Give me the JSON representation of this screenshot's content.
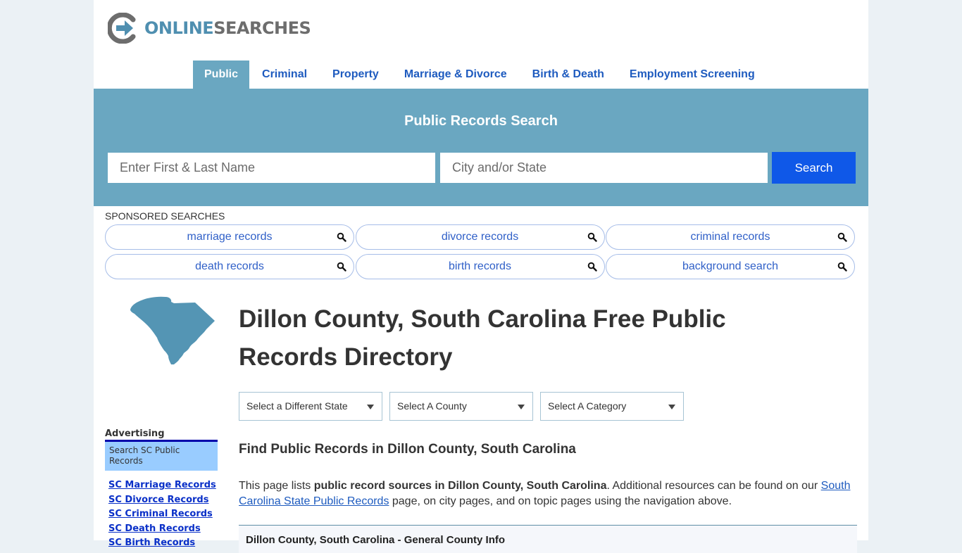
{
  "header": {
    "logo_online": "ONLINE",
    "logo_searches": "SEARCHES"
  },
  "nav": {
    "items": [
      {
        "label": "Public",
        "active": true
      },
      {
        "label": "Criminal"
      },
      {
        "label": "Property"
      },
      {
        "label": "Marriage & Divorce"
      },
      {
        "label": "Birth & Death"
      },
      {
        "label": "Employment Screening"
      }
    ]
  },
  "search": {
    "title": "Public Records Search",
    "name_placeholder": "Enter First & Last Name",
    "location_placeholder": "City and/or State",
    "button_label": "Search"
  },
  "sponsored": {
    "label": "SPONSORED SEARCHES",
    "items": [
      "marriage records",
      "divorce records",
      "criminal records",
      "death records",
      "birth records",
      "background search"
    ]
  },
  "sidebar": {
    "advertising_label": "Advertising",
    "box_text": "Search SC Public Records",
    "links": [
      "SC Marriage Records",
      "SC Divorce Records",
      "SC Criminal Records",
      "SC Death Records",
      "SC Birth Records"
    ]
  },
  "main": {
    "title": "Dillon County, South Carolina Free Public Records Directory",
    "selects": [
      "Select a Different State",
      "Select A County",
      "Select A Category"
    ],
    "find_heading": "Find Public Records in Dillon County, South Carolina",
    "intro": {
      "prefix": "This page lists ",
      "bold": "public record sources in Dillon County, South Carolina",
      "middle": ". Additional resources can be found on our ",
      "link": "South Carolina State Public Records",
      "suffix": " page, on city pages, and on topic pages using the navigation above."
    },
    "info_box_title": "Dillon County, South Carolina - General County Info"
  },
  "colors": {
    "accent": "#6aa7c1",
    "search_button": "#0f58e8",
    "nav_link": "#1e5bbf",
    "state_map": "#5495b4",
    "sidebar_box": "#99ccff"
  }
}
